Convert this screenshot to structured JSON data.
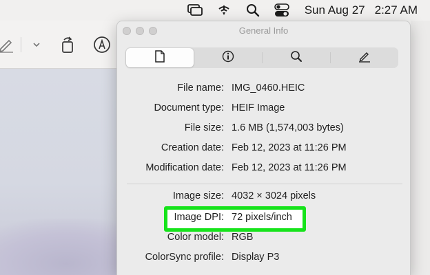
{
  "menubar": {
    "icons": [
      "screen-mirroring-icon",
      "wifi-icon",
      "spotlight-search-icon",
      "control-center-icon"
    ],
    "date": "Sun Aug 27",
    "time": "2:27 AM"
  },
  "toolbar": {
    "icons": [
      "markup-pen-icon",
      "chevron-down-icon",
      "rotate-icon",
      "annotate-icon"
    ]
  },
  "panel": {
    "title": "General Info",
    "tabs": [
      {
        "icon": "document-icon",
        "active": true
      },
      {
        "icon": "info-icon",
        "active": false
      },
      {
        "icon": "magnifier-icon",
        "active": false
      },
      {
        "icon": "pencil-icon",
        "active": false
      }
    ],
    "rows": [
      {
        "label": "File name:",
        "value": "IMG_0460.HEIC"
      },
      {
        "label": "Document type:",
        "value": "HEIF Image"
      },
      {
        "label": "File size:",
        "value": "1.6 MB (1,574,003 bytes)"
      },
      {
        "label": "Creation date:",
        "value": "Feb 12, 2023 at 11:26 PM"
      },
      {
        "label": "Modification date:",
        "value": "Feb 12, 2023 at 11:26 PM"
      },
      {
        "label": "Image size:",
        "value": "4032 × 3024 pixels"
      },
      {
        "label": "Image DPI:",
        "value": "72 pixels/inch"
      },
      {
        "label": "Color model:",
        "value": "RGB"
      },
      {
        "label": "ColorSync profile:",
        "value": "Display P3"
      }
    ]
  },
  "colors": {
    "highlight": "#16e31b",
    "panel_bg": "#ebebeb",
    "menubar_bg": "#f1f0ef"
  }
}
